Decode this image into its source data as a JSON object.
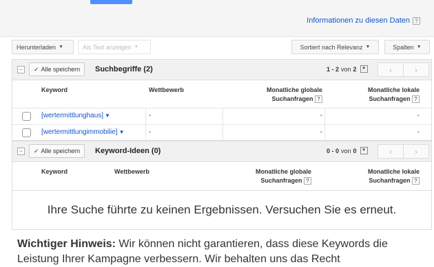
{
  "header": {
    "info_link": "Informationen zu diesen Daten",
    "help": "?"
  },
  "toolbar": {
    "download": "Herunterladen",
    "show_text": "Als Text anzeigen",
    "sort": "Sortiert nach Relevanz",
    "columns": "Spalten"
  },
  "search_terms": {
    "collapse": "⊟",
    "save_all": "Alle speichern",
    "title": "Suchbegriffe (2)",
    "range": "1 - 2",
    "of": "von",
    "total": "2",
    "columns": {
      "keyword": "Keyword",
      "competition": "Wettbewerb",
      "global_line1": "Monatliche globale",
      "global_line2": "Suchanfragen",
      "local_line1": "Monatliche lokale",
      "local_line2": "Suchanfragen"
    },
    "rows": [
      {
        "keyword": "[wertermittlunghaus]",
        "competition": "-",
        "global": "-",
        "local": "-"
      },
      {
        "keyword": "[wertermittlungimmobilie]",
        "competition": "-",
        "global": "-",
        "local": "-"
      }
    ]
  },
  "keyword_ideas": {
    "save_all": "Alle speichern",
    "title": "Keyword-Ideen (0)",
    "range": "0 - 0",
    "of": "von",
    "total": "0",
    "columns": {
      "keyword": "Keyword",
      "competition": "Wettbewerb",
      "global_line1": "Monatliche globale",
      "global_line2": "Suchanfragen",
      "local_line1": "Monatliche lokale",
      "local_line2": "Suchanfragen"
    },
    "empty_message": "Ihre Suche führte zu keinen Ergebnissen. Versuchen Sie es erneut."
  },
  "notice": {
    "label": "Wichtiger Hinweis:",
    "text": " Wir können nicht garantieren, dass diese Keywords die Leistung Ihrer Kampagne verbessern. Wir behalten uns das Recht"
  }
}
